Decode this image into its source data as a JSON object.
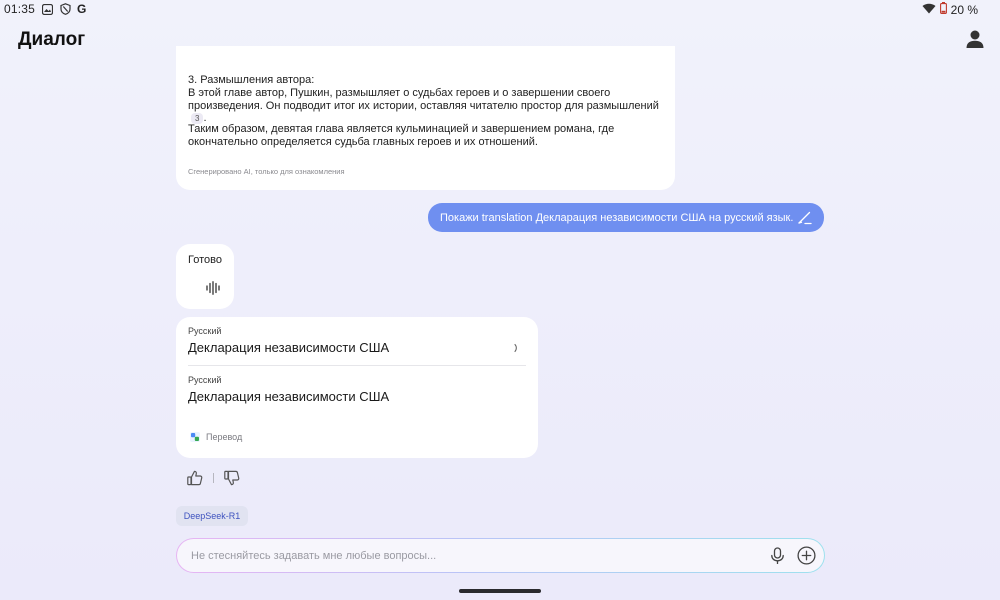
{
  "status_bar": {
    "time": "01:35",
    "google_label": "G",
    "battery": "20 %",
    "icons": [
      "gallery-icon",
      "shield-icon",
      "google-icon",
      "wifi-icon",
      "battery-icon"
    ]
  },
  "header": {
    "title": "Диалог",
    "user_icon": "user-icon"
  },
  "ai_message": {
    "cut_line": "…",
    "heading": "3. Размышления автора:",
    "paragraph1": "В этой главе автор, Пушкин, размышляет о судьбах героев и о завершении своего произведения. Он подводит итог их истории, оставляя читателю простор для размышлений",
    "citation": "3",
    "paragraph1_end": ".",
    "paragraph2": "Таким образом, девятая глава является кульминацией и завершением романа, где окончательно определяется судьба главных героев и их отношений.",
    "note": "Сгенерировано AI, только для ознакомления"
  },
  "user_message": {
    "text": "Покажи translation Декларация независимости США на русский язык.",
    "edit_icon": "edit-icon"
  },
  "status_card": {
    "label": "Готово",
    "icon": "sound-wave-icon"
  },
  "translation": {
    "source_lang": "Русский",
    "source_text": "Декларация независимости США",
    "target_lang": "Русский",
    "target_text": "Декларация независимости США",
    "source_label": "Перевод"
  },
  "model": {
    "name": "DeepSeek-R1"
  },
  "input": {
    "placeholder": "Не стесняйтесь задавать мне любые вопросы...",
    "value": ""
  },
  "colors": {
    "user_bubble": "#6f8ff0",
    "model_chip_text": "#3f53bf",
    "background": "#eeeefb"
  }
}
